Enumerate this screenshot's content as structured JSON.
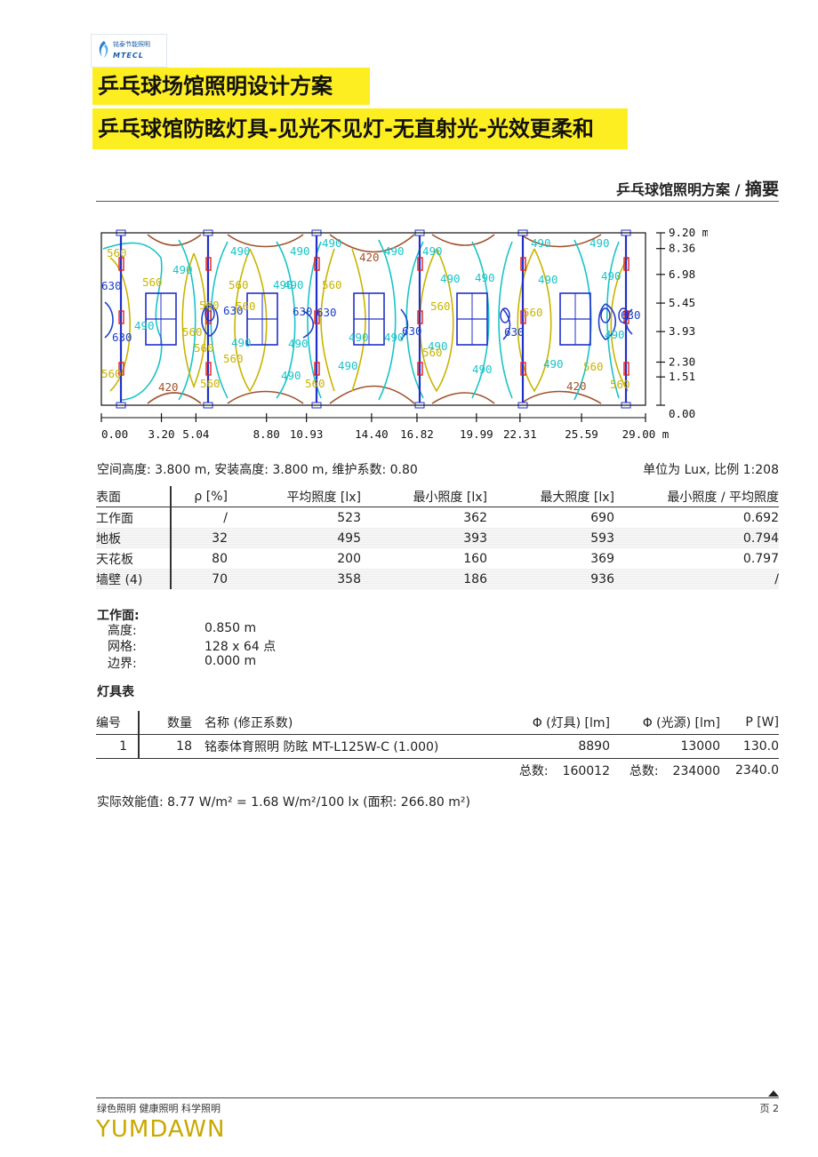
{
  "logo": {
    "cn": "铭泰节能照明",
    "en": "MTECL"
  },
  "banners": {
    "line1": "乒乓球场馆照明设计方案",
    "line2": "乒乓球馆防眩灯具-见光不见灯-无直射光-光效更柔和"
  },
  "header": {
    "title": "乒乓球馆照明方案",
    "sep": " / ",
    "section": "摘要"
  },
  "plan": {
    "x_ticks": [
      "0.00",
      "3.20",
      "5.04",
      "8.80",
      "10.93",
      "14.40",
      "16.82",
      "19.99",
      "22.31",
      "25.59",
      "29.00 m"
    ],
    "y_ticks": [
      "9.20 m",
      "8.36",
      "6.98",
      "5.45",
      "3.93",
      "2.30",
      "1.51",
      "0.00"
    ],
    "contour_labels": {
      "l420": "420",
      "l490": "490",
      "l560": "560",
      "l630": "630"
    },
    "colors": {
      "c420": "#a0522d",
      "c490": "#19c3c9",
      "c560": "#c8b400",
      "c630": "#1e40c8",
      "luminaire": "#e02020",
      "rack": "#2030c8"
    }
  },
  "meta": {
    "left": "空间高度: 3.800 m, 安装高度: 3.800 m, 维护系数: 0.80",
    "right": "单位为 Lux, 比例  1:208"
  },
  "surfaces": {
    "headers": [
      "表面",
      "ρ [%]",
      "平均照度 [lx]",
      "最小照度 [lx]",
      "最大照度 [lx]",
      "最小照度 / 平均照度"
    ],
    "rows": [
      [
        "工作面",
        "/",
        "523",
        "362",
        "690",
        "0.692"
      ],
      [
        "地板",
        "32",
        "495",
        "393",
        "593",
        "0.794"
      ],
      [
        "天花板",
        "80",
        "200",
        "160",
        "369",
        "0.797"
      ],
      [
        "墙壁 (4)",
        "70",
        "358",
        "186",
        "936",
        "/"
      ]
    ]
  },
  "workplane": {
    "title": "工作面:",
    "rows": [
      {
        "label": "高度:",
        "value": "0.850 m"
      },
      {
        "label": "网格:",
        "value": "128 x 64 点"
      },
      {
        "label": "边界:",
        "value": "0.000 m"
      }
    ]
  },
  "luminaires": {
    "title": "灯具表",
    "headers": [
      "编号",
      "数量",
      "名称 (修正系数)",
      "Φ (灯具) [lm]",
      "Φ (光源) [lm]",
      "P [W]"
    ],
    "rows": [
      [
        "1",
        "18",
        "铭泰体育照明  防眩  MT-L125W-C (1.000)",
        "8890",
        "13000",
        "130.0"
      ]
    ],
    "totals": {
      "label1": "总数:",
      "lum": "160012",
      "label2": "总数:",
      "lamp": "234000",
      "power": "2340.0"
    }
  },
  "efficiency": "实际效能值: 8.77 W/m² = 1.68 W/m²/100 lx (面积: 266.80 m²)",
  "footer": {
    "slogan": "绿色照明  健康照明  科学照明",
    "page": "页 2",
    "brand": "YUMDAWN"
  }
}
